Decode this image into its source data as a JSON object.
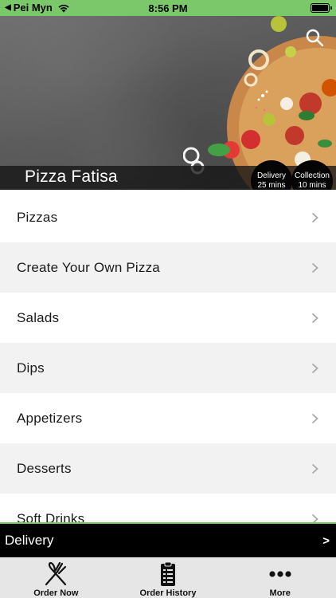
{
  "status_bar": {
    "carrier": "Pei Myn",
    "time": "8:56 PM"
  },
  "hero": {
    "restaurant_name": "Pizza Fatisa",
    "delivery_badge": {
      "line1": "Delivery",
      "line2": "25 mins"
    },
    "collection_badge": {
      "line1": "Collection",
      "line2": "10 mins"
    },
    "search_icon": "search-icon"
  },
  "menu": {
    "categories": [
      {
        "label": "Pizzas"
      },
      {
        "label": "Create Your Own Pizza"
      },
      {
        "label": "Salads"
      },
      {
        "label": "Dips"
      },
      {
        "label": "Appetizers"
      },
      {
        "label": "Desserts"
      },
      {
        "label": "Soft Drinks"
      }
    ]
  },
  "delivery_bar": {
    "label": "Delivery",
    "arrow": ">"
  },
  "tab_bar": {
    "tabs": [
      {
        "label": "Order Now",
        "icon": "fork-knife-icon"
      },
      {
        "label": "Order History",
        "icon": "clipboard-icon"
      },
      {
        "label": "More",
        "icon": "more-dots-icon"
      }
    ]
  },
  "colors": {
    "accent_green": "#7bc86a",
    "bar_black": "#000000",
    "tab_bg": "#e6e6e6"
  }
}
